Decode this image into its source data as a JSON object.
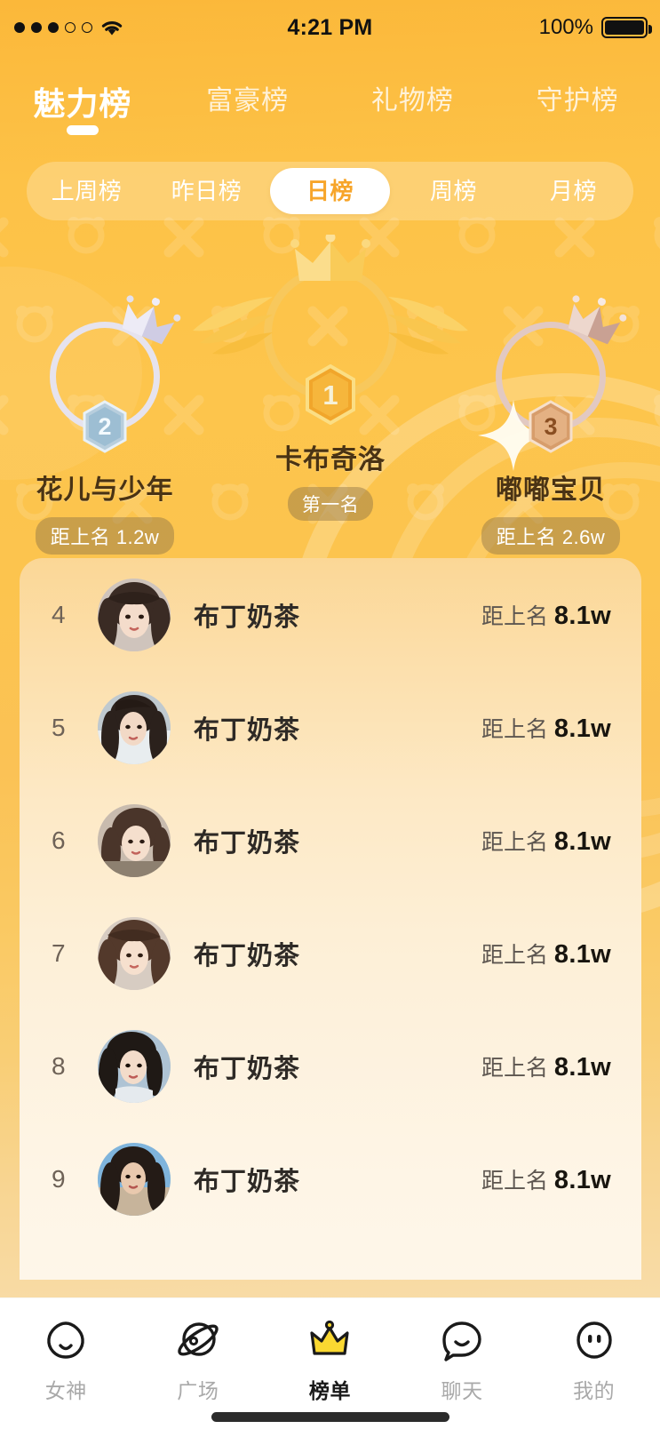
{
  "status_bar": {
    "signal_dots_filled": 3,
    "signal_dots_total": 5,
    "wifi_icon": "wifi-icon",
    "time": "4:21 PM",
    "battery_percent": "100%",
    "battery_icon": "battery-full-icon"
  },
  "top_tabs": {
    "active_index": 0,
    "items": [
      {
        "label": "魅力榜"
      },
      {
        "label": "富豪榜"
      },
      {
        "label": "礼物榜"
      },
      {
        "label": "守护榜"
      }
    ]
  },
  "period_tabs": {
    "active_index": 2,
    "items": [
      {
        "label": "上周榜"
      },
      {
        "label": "昨日榜"
      },
      {
        "label": "日榜"
      },
      {
        "label": "周榜"
      },
      {
        "label": "月榜"
      }
    ]
  },
  "podium": {
    "first": {
      "rank": "1",
      "name": "卡布奇洛",
      "badge": "第一名",
      "crown_icon": "crown-gold-icon",
      "wings_icon": "wings-gold-icon",
      "ring_color": "#F8C85C"
    },
    "second": {
      "rank": "2",
      "name": "花儿与少年",
      "badge": "距上名 1.2w",
      "crown_icon": "crown-silver-icon",
      "ring_color": "#E6E3EE"
    },
    "third": {
      "rank": "3",
      "name": "嘟嘟宝贝",
      "badge": "距上名 2.6w",
      "crown_icon": "crown-bronze-icon",
      "sparkle_icon": "sparkle-icon",
      "ring_color": "#E2C9C2"
    }
  },
  "rank_list": {
    "score_prefix": "距上名",
    "rows": [
      {
        "rank": "4",
        "name": "布丁奶茶",
        "score": "8.1w",
        "avatar": "avatar-photo-1"
      },
      {
        "rank": "5",
        "name": "布丁奶茶",
        "score": "8.1w",
        "avatar": "avatar-photo-2"
      },
      {
        "rank": "6",
        "name": "布丁奶茶",
        "score": "8.1w",
        "avatar": "avatar-photo-3"
      },
      {
        "rank": "7",
        "name": "布丁奶茶",
        "score": "8.1w",
        "avatar": "avatar-photo-4"
      },
      {
        "rank": "8",
        "name": "布丁奶茶",
        "score": "8.1w",
        "avatar": "avatar-photo-5"
      },
      {
        "rank": "9",
        "name": "布丁奶茶",
        "score": "8.1w",
        "avatar": "avatar-photo-6"
      }
    ]
  },
  "bottom_nav": {
    "active_index": 2,
    "items": [
      {
        "label": "女神",
        "icon": "goddess-face-icon"
      },
      {
        "label": "广场",
        "icon": "planet-icon"
      },
      {
        "label": "榜单",
        "icon": "crown-icon"
      },
      {
        "label": "聊天",
        "icon": "chat-bubble-icon"
      },
      {
        "label": "我的",
        "icon": "profile-face-icon"
      }
    ]
  },
  "colors": {
    "brand_orange": "#FBBE42",
    "accent_gold": "#F8C85C",
    "active_tab_text": "#F7A52A",
    "nav_active": "#1A1A1A",
    "crown_yellow": "#FAD831"
  }
}
